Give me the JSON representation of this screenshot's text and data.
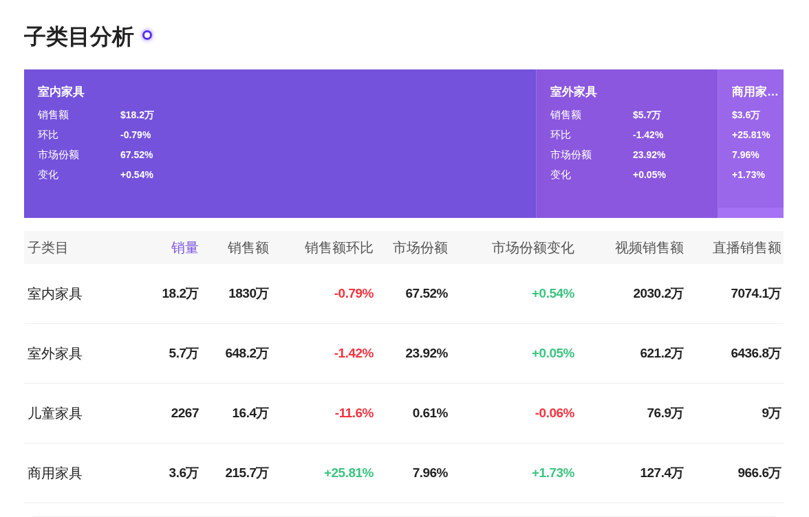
{
  "title": "子类目分析",
  "treemap": {
    "tiles": [
      {
        "label": "室内家具",
        "color": "#7452db",
        "metrics": [
          {
            "label": "销售额",
            "value": "$18.2万"
          },
          {
            "label": "环比",
            "value": "-0.79%"
          },
          {
            "label": "市场份额",
            "value": "67.52%"
          },
          {
            "label": "变化",
            "value": "+0.54%"
          }
        ]
      },
      {
        "label": "室外家具",
        "color": "#8a57de",
        "metrics": [
          {
            "label": "销售额",
            "value": "$5.7万"
          },
          {
            "label": "环比",
            "value": "-1.42%"
          },
          {
            "label": "市场份额",
            "value": "23.92%"
          },
          {
            "label": "变化",
            "value": "+0.05%"
          }
        ]
      },
      {
        "label": "商用家…",
        "color": "#9a66ea",
        "metrics": [
          {
            "value": "$3.6万"
          },
          {
            "value": "+25.81%"
          },
          {
            "value": "7.96%"
          },
          {
            "value": "+1.73%"
          }
        ]
      },
      {
        "color": "#a672f5"
      }
    ]
  },
  "table": {
    "columns": [
      {
        "label": "子类目",
        "sorted": false
      },
      {
        "label": "销量",
        "sorted": true
      },
      {
        "label": "销售额",
        "sorted": false
      },
      {
        "label": "销售额环比",
        "sorted": false
      },
      {
        "label": "市场份额",
        "sorted": false
      },
      {
        "label": "市场份额变化",
        "sorted": false
      },
      {
        "label": "视频销售额",
        "sorted": false
      },
      {
        "label": "直播销售额",
        "sorted": false
      }
    ],
    "rows": [
      {
        "cells": [
          {
            "text": "室内家具"
          },
          {
            "text": "18.2万"
          },
          {
            "text": "1830万"
          },
          {
            "text": "-0.79%",
            "color": "#f5333f"
          },
          {
            "text": "67.52%"
          },
          {
            "text": "+0.54%",
            "color": "#3cc480"
          },
          {
            "text": "2030.2万"
          },
          {
            "text": "7074.1万"
          }
        ]
      },
      {
        "cells": [
          {
            "text": "室外家具"
          },
          {
            "text": "5.7万"
          },
          {
            "text": "648.2万"
          },
          {
            "text": "-1.42%",
            "color": "#f5333f"
          },
          {
            "text": "23.92%"
          },
          {
            "text": "+0.05%",
            "color": "#3cc480"
          },
          {
            "text": "621.2万"
          },
          {
            "text": "6436.8万"
          }
        ]
      },
      {
        "cells": [
          {
            "text": "儿童家具"
          },
          {
            "text": "2267"
          },
          {
            "text": "16.4万"
          },
          {
            "text": "-11.6%",
            "color": "#f5333f"
          },
          {
            "text": "0.61%"
          },
          {
            "text": "-0.06%",
            "color": "#f5333f"
          },
          {
            "text": "76.9万"
          },
          {
            "text": "9万"
          }
        ]
      },
      {
        "cells": [
          {
            "text": "商用家具"
          },
          {
            "text": "3.6万"
          },
          {
            "text": "215.7万"
          },
          {
            "text": "+25.81%",
            "color": "#3cc480"
          },
          {
            "text": "7.96%"
          },
          {
            "text": "+1.73%",
            "color": "#3cc480"
          },
          {
            "text": "127.4万"
          },
          {
            "text": "966.6万"
          }
        ]
      }
    ]
  }
}
